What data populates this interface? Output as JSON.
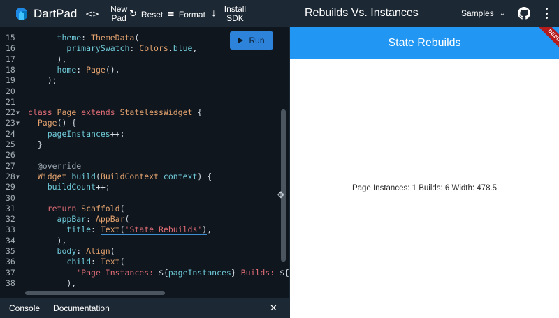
{
  "app": {
    "name": "DartPad",
    "window_title": "Rebuilds Vs. Instances"
  },
  "toolbar": {
    "new_pad_line1": "New",
    "new_pad_line2": "Pad",
    "reset_label": "Reset",
    "format_label": "Format",
    "install_line1": "Install",
    "install_line2": "SDK",
    "samples_label": "Samples"
  },
  "editor": {
    "run_label": "Run",
    "lines": [
      {
        "n": "15",
        "fold": false,
        "tokens": [
          [
            "d",
            "      "
          ],
          [
            "p",
            "theme"
          ],
          [
            "d",
            ": "
          ],
          [
            "t",
            "ThemeData"
          ],
          [
            "d",
            "("
          ]
        ]
      },
      {
        "n": "16",
        "fold": false,
        "tokens": [
          [
            "d",
            "        "
          ],
          [
            "p",
            "primarySwatch"
          ],
          [
            "d",
            ": "
          ],
          [
            "t",
            "Colors"
          ],
          [
            "d",
            "."
          ],
          [
            "p",
            "blue"
          ],
          [
            "d",
            ","
          ]
        ]
      },
      {
        "n": "17",
        "fold": false,
        "tokens": [
          [
            "d",
            "      ),"
          ]
        ]
      },
      {
        "n": "18",
        "fold": false,
        "tokens": [
          [
            "d",
            "      "
          ],
          [
            "p",
            "home"
          ],
          [
            "d",
            ": "
          ],
          [
            "t",
            "Page"
          ],
          [
            "d",
            "(),"
          ]
        ]
      },
      {
        "n": "19",
        "fold": false,
        "tokens": [
          [
            "d",
            "    );"
          ]
        ]
      },
      {
        "n": "20",
        "fold": false,
        "tokens": [
          [
            "d",
            "  "
          ]
        ]
      },
      {
        "n": "21",
        "fold": false,
        "tokens": [
          [
            "d",
            ""
          ]
        ]
      },
      {
        "n": "22",
        "fold": true,
        "tokens": [
          [
            "k",
            "class "
          ],
          [
            "t",
            "Page "
          ],
          [
            "k",
            "extends "
          ],
          [
            "t",
            "StatelessWidget "
          ],
          [
            "d",
            "{"
          ]
        ]
      },
      {
        "n": "23",
        "fold": true,
        "tokens": [
          [
            "d",
            "  "
          ],
          [
            "t",
            "Page"
          ],
          [
            "d",
            "() {"
          ]
        ]
      },
      {
        "n": "24",
        "fold": false,
        "tokens": [
          [
            "d",
            "    "
          ],
          [
            "p",
            "pageInstances"
          ],
          [
            "d",
            "++;"
          ]
        ]
      },
      {
        "n": "25",
        "fold": false,
        "tokens": [
          [
            "d",
            "  }"
          ]
        ]
      },
      {
        "n": "26",
        "fold": false,
        "tokens": [
          [
            "d",
            ""
          ]
        ]
      },
      {
        "n": "27",
        "fold": false,
        "tokens": [
          [
            "d",
            "  "
          ],
          [
            "c",
            "@override"
          ]
        ]
      },
      {
        "n": "28",
        "fold": true,
        "tokens": [
          [
            "d",
            "  "
          ],
          [
            "t",
            "Widget "
          ],
          [
            "p",
            "build"
          ],
          [
            "d",
            "("
          ],
          [
            "t",
            "BuildContext "
          ],
          [
            "p",
            "context"
          ],
          [
            "d",
            ") {"
          ]
        ]
      },
      {
        "n": "29",
        "fold": false,
        "tokens": [
          [
            "d",
            "    "
          ],
          [
            "p",
            "buildCount"
          ],
          [
            "d",
            "++;"
          ]
        ]
      },
      {
        "n": "30",
        "fold": false,
        "tokens": [
          [
            "d",
            ""
          ]
        ]
      },
      {
        "n": "31",
        "fold": false,
        "tokens": [
          [
            "d",
            "    "
          ],
          [
            "k",
            "return "
          ],
          [
            "t",
            "Scaffold"
          ],
          [
            "d",
            "("
          ]
        ]
      },
      {
        "n": "32",
        "fold": false,
        "tokens": [
          [
            "d",
            "      "
          ],
          [
            "p",
            "appBar"
          ],
          [
            "d",
            ": "
          ],
          [
            "t",
            "AppBar"
          ],
          [
            "d",
            "("
          ]
        ]
      },
      {
        "n": "33",
        "fold": false,
        "tokens": [
          [
            "d",
            "        "
          ],
          [
            "p",
            "title"
          ],
          [
            "d",
            ": "
          ],
          [
            "tu",
            "Text"
          ],
          [
            "du",
            "("
          ],
          [
            "su",
            "'State Rebuilds'"
          ],
          [
            "du",
            ")"
          ],
          [
            "d",
            ","
          ]
        ]
      },
      {
        "n": "34",
        "fold": false,
        "tokens": [
          [
            "d",
            "      ),"
          ]
        ]
      },
      {
        "n": "35",
        "fold": false,
        "tokens": [
          [
            "d",
            "      "
          ],
          [
            "p",
            "body"
          ],
          [
            "d",
            ": "
          ],
          [
            "t",
            "Align"
          ],
          [
            "d",
            "("
          ]
        ]
      },
      {
        "n": "36",
        "fold": false,
        "tokens": [
          [
            "d",
            "        "
          ],
          [
            "p",
            "child"
          ],
          [
            "d",
            ": "
          ],
          [
            "t",
            "Text"
          ],
          [
            "d",
            "("
          ]
        ]
      },
      {
        "n": "37",
        "fold": false,
        "tokens": [
          [
            "d",
            "          "
          ],
          [
            "s",
            "'Page Instances: "
          ],
          [
            "du",
            "${"
          ],
          [
            "pu",
            "pageInstances"
          ],
          [
            "du",
            "}"
          ],
          [
            "s",
            " Builds: "
          ],
          [
            "du",
            "${"
          ],
          [
            "pu",
            "bui"
          ]
        ]
      },
      {
        "n": "38",
        "fold": false,
        "tokens": [
          [
            "d",
            "        ),"
          ]
        ]
      }
    ]
  },
  "console": {
    "console_tab": "Console",
    "docs_tab": "Documentation"
  },
  "output": {
    "appbar_title": "State Rebuilds",
    "debug_label": "DEBUG",
    "body_text": "Page Instances: 1 Builds: 6 Width: 478.5"
  },
  "colors": {
    "accent": "#2196f3",
    "run_button": "#2d82da",
    "debug_banner": "#b71c1c",
    "editor_bg": "#0f161e",
    "chrome_bg": "#1c2834"
  }
}
